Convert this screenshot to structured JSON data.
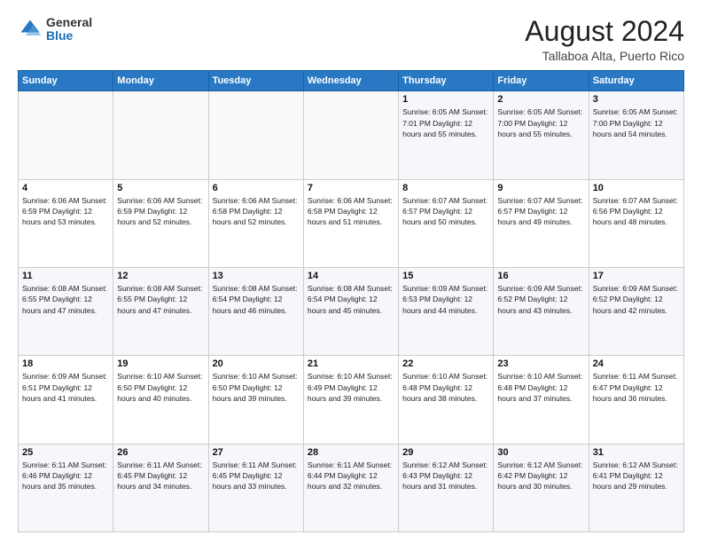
{
  "header": {
    "logo_general": "General",
    "logo_blue": "Blue",
    "month": "August 2024",
    "location": "Tallaboa Alta, Puerto Rico"
  },
  "weekdays": [
    "Sunday",
    "Monday",
    "Tuesday",
    "Wednesday",
    "Thursday",
    "Friday",
    "Saturday"
  ],
  "weeks": [
    [
      {
        "day": "",
        "info": ""
      },
      {
        "day": "",
        "info": ""
      },
      {
        "day": "",
        "info": ""
      },
      {
        "day": "",
        "info": ""
      },
      {
        "day": "1",
        "info": "Sunrise: 6:05 AM\nSunset: 7:01 PM\nDaylight: 12 hours\nand 55 minutes."
      },
      {
        "day": "2",
        "info": "Sunrise: 6:05 AM\nSunset: 7:00 PM\nDaylight: 12 hours\nand 55 minutes."
      },
      {
        "day": "3",
        "info": "Sunrise: 6:05 AM\nSunset: 7:00 PM\nDaylight: 12 hours\nand 54 minutes."
      }
    ],
    [
      {
        "day": "4",
        "info": "Sunrise: 6:06 AM\nSunset: 6:59 PM\nDaylight: 12 hours\nand 53 minutes."
      },
      {
        "day": "5",
        "info": "Sunrise: 6:06 AM\nSunset: 6:59 PM\nDaylight: 12 hours\nand 52 minutes."
      },
      {
        "day": "6",
        "info": "Sunrise: 6:06 AM\nSunset: 6:58 PM\nDaylight: 12 hours\nand 52 minutes."
      },
      {
        "day": "7",
        "info": "Sunrise: 6:06 AM\nSunset: 6:58 PM\nDaylight: 12 hours\nand 51 minutes."
      },
      {
        "day": "8",
        "info": "Sunrise: 6:07 AM\nSunset: 6:57 PM\nDaylight: 12 hours\nand 50 minutes."
      },
      {
        "day": "9",
        "info": "Sunrise: 6:07 AM\nSunset: 6:57 PM\nDaylight: 12 hours\nand 49 minutes."
      },
      {
        "day": "10",
        "info": "Sunrise: 6:07 AM\nSunset: 6:56 PM\nDaylight: 12 hours\nand 48 minutes."
      }
    ],
    [
      {
        "day": "11",
        "info": "Sunrise: 6:08 AM\nSunset: 6:55 PM\nDaylight: 12 hours\nand 47 minutes."
      },
      {
        "day": "12",
        "info": "Sunrise: 6:08 AM\nSunset: 6:55 PM\nDaylight: 12 hours\nand 47 minutes."
      },
      {
        "day": "13",
        "info": "Sunrise: 6:08 AM\nSunset: 6:54 PM\nDaylight: 12 hours\nand 46 minutes."
      },
      {
        "day": "14",
        "info": "Sunrise: 6:08 AM\nSunset: 6:54 PM\nDaylight: 12 hours\nand 45 minutes."
      },
      {
        "day": "15",
        "info": "Sunrise: 6:09 AM\nSunset: 6:53 PM\nDaylight: 12 hours\nand 44 minutes."
      },
      {
        "day": "16",
        "info": "Sunrise: 6:09 AM\nSunset: 6:52 PM\nDaylight: 12 hours\nand 43 minutes."
      },
      {
        "day": "17",
        "info": "Sunrise: 6:09 AM\nSunset: 6:52 PM\nDaylight: 12 hours\nand 42 minutes."
      }
    ],
    [
      {
        "day": "18",
        "info": "Sunrise: 6:09 AM\nSunset: 6:51 PM\nDaylight: 12 hours\nand 41 minutes."
      },
      {
        "day": "19",
        "info": "Sunrise: 6:10 AM\nSunset: 6:50 PM\nDaylight: 12 hours\nand 40 minutes."
      },
      {
        "day": "20",
        "info": "Sunrise: 6:10 AM\nSunset: 6:50 PM\nDaylight: 12 hours\nand 39 minutes."
      },
      {
        "day": "21",
        "info": "Sunrise: 6:10 AM\nSunset: 6:49 PM\nDaylight: 12 hours\nand 39 minutes."
      },
      {
        "day": "22",
        "info": "Sunrise: 6:10 AM\nSunset: 6:48 PM\nDaylight: 12 hours\nand 38 minutes."
      },
      {
        "day": "23",
        "info": "Sunrise: 6:10 AM\nSunset: 6:48 PM\nDaylight: 12 hours\nand 37 minutes."
      },
      {
        "day": "24",
        "info": "Sunrise: 6:11 AM\nSunset: 6:47 PM\nDaylight: 12 hours\nand 36 minutes."
      }
    ],
    [
      {
        "day": "25",
        "info": "Sunrise: 6:11 AM\nSunset: 6:46 PM\nDaylight: 12 hours\nand 35 minutes."
      },
      {
        "day": "26",
        "info": "Sunrise: 6:11 AM\nSunset: 6:45 PM\nDaylight: 12 hours\nand 34 minutes."
      },
      {
        "day": "27",
        "info": "Sunrise: 6:11 AM\nSunset: 6:45 PM\nDaylight: 12 hours\nand 33 minutes."
      },
      {
        "day": "28",
        "info": "Sunrise: 6:11 AM\nSunset: 6:44 PM\nDaylight: 12 hours\nand 32 minutes."
      },
      {
        "day": "29",
        "info": "Sunrise: 6:12 AM\nSunset: 6:43 PM\nDaylight: 12 hours\nand 31 minutes."
      },
      {
        "day": "30",
        "info": "Sunrise: 6:12 AM\nSunset: 6:42 PM\nDaylight: 12 hours\nand 30 minutes."
      },
      {
        "day": "31",
        "info": "Sunrise: 6:12 AM\nSunset: 6:41 PM\nDaylight: 12 hours\nand 29 minutes."
      }
    ]
  ]
}
